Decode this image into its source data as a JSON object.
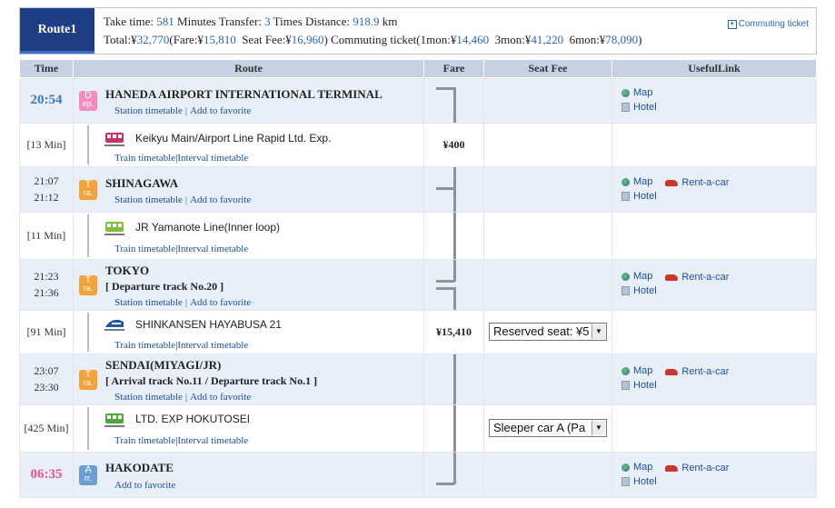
{
  "summary": {
    "route_label": "Route1",
    "take_time_label": "Take time:",
    "take_time_value": "581",
    "minutes_label": "Minutes",
    "transfer_label": "Transfer:",
    "transfer_value": "3",
    "times_label": "Times",
    "distance_label": "Distance:",
    "distance_value": "918.9",
    "km_label": "km",
    "total_label": "Total:¥",
    "total_value": "32,770",
    "fare_label": "(Fare:¥",
    "fare_value": "15,810",
    "seat_fee_label": "Seat Fee:¥",
    "seat_fee_value": "16,960",
    "commuting_label": ")  Commuting ticket(1mon:¥",
    "commute_1mon": "14,460",
    "mon3_label": "3mon:¥",
    "commute_3mon": "41,220",
    "mon6_label": "6mon:¥",
    "commute_6mon": "78,090",
    "close_paren": ")",
    "commuting_link": "Commuting ticket"
  },
  "columns": [
    "Time",
    "Route",
    "Fare",
    "Seat Fee",
    "UsefulLink"
  ],
  "links": {
    "station_timetable": "Station timetable",
    "add_to_favorite": "Add to favorite",
    "train_timetable": "Train timetable",
    "interval_timetable": "Interval timetable",
    "separator": "|",
    "map": "Map",
    "hotel": "Hotel",
    "rent_a_car": "Rent-a-car"
  },
  "stations": [
    {
      "time": "20:54",
      "badge_top": "D",
      "badge_bottom": "ep.",
      "name": "HANEDA AIRPORT INTERNATIONAL TERMINAL",
      "sub": ""
    },
    {
      "time_arr": "21:07",
      "time_dep": "21:12",
      "badge_top": "T",
      "badge_bottom": "ra.",
      "name": "SHINAGAWA",
      "sub": ""
    },
    {
      "time_arr": "21:23",
      "time_dep": "21:36",
      "badge_top": "T",
      "badge_bottom": "ra.",
      "name": "TOKYO",
      "sub": "[ Departure track No.20 ]"
    },
    {
      "time_arr": "23:07",
      "time_dep": "23:30",
      "badge_top": "T",
      "badge_bottom": "ra.",
      "name": "SENDAI(MIYAGI/JR)",
      "sub": "[ Arrival track No.11 / Departure track No.1 ]"
    },
    {
      "time": "06:35",
      "badge_top": "A",
      "badge_bottom": "rr.",
      "name": "HAKODATE",
      "sub": ""
    }
  ],
  "segments": [
    {
      "duration": "[13 Min]",
      "train": "Keikyu Main/Airport Line Rapid Ltd. Exp.",
      "fare": "¥400",
      "seat": "",
      "icon": "train-icon",
      "color": "#c8336e"
    },
    {
      "duration": "[11 Min]",
      "train": "JR Yamanote Line(Inner loop)",
      "fare": "",
      "seat": "",
      "icon": "train-icon",
      "color": "#7cbf3a"
    },
    {
      "duration": "[91 Min]",
      "train": "SHINKANSEN HAYABUSA 21",
      "fare": "¥15,410",
      "seat": "Reserved seat: ¥5",
      "icon": "shinkansen-icon",
      "color": "#1e5aa8"
    },
    {
      "duration": "[425 Min]",
      "train": "LTD. EXP HOKUTOSEI",
      "fare": "",
      "seat": "Sleeper car A (Pa",
      "icon": "train-icon",
      "color": "#4fa83d"
    }
  ]
}
